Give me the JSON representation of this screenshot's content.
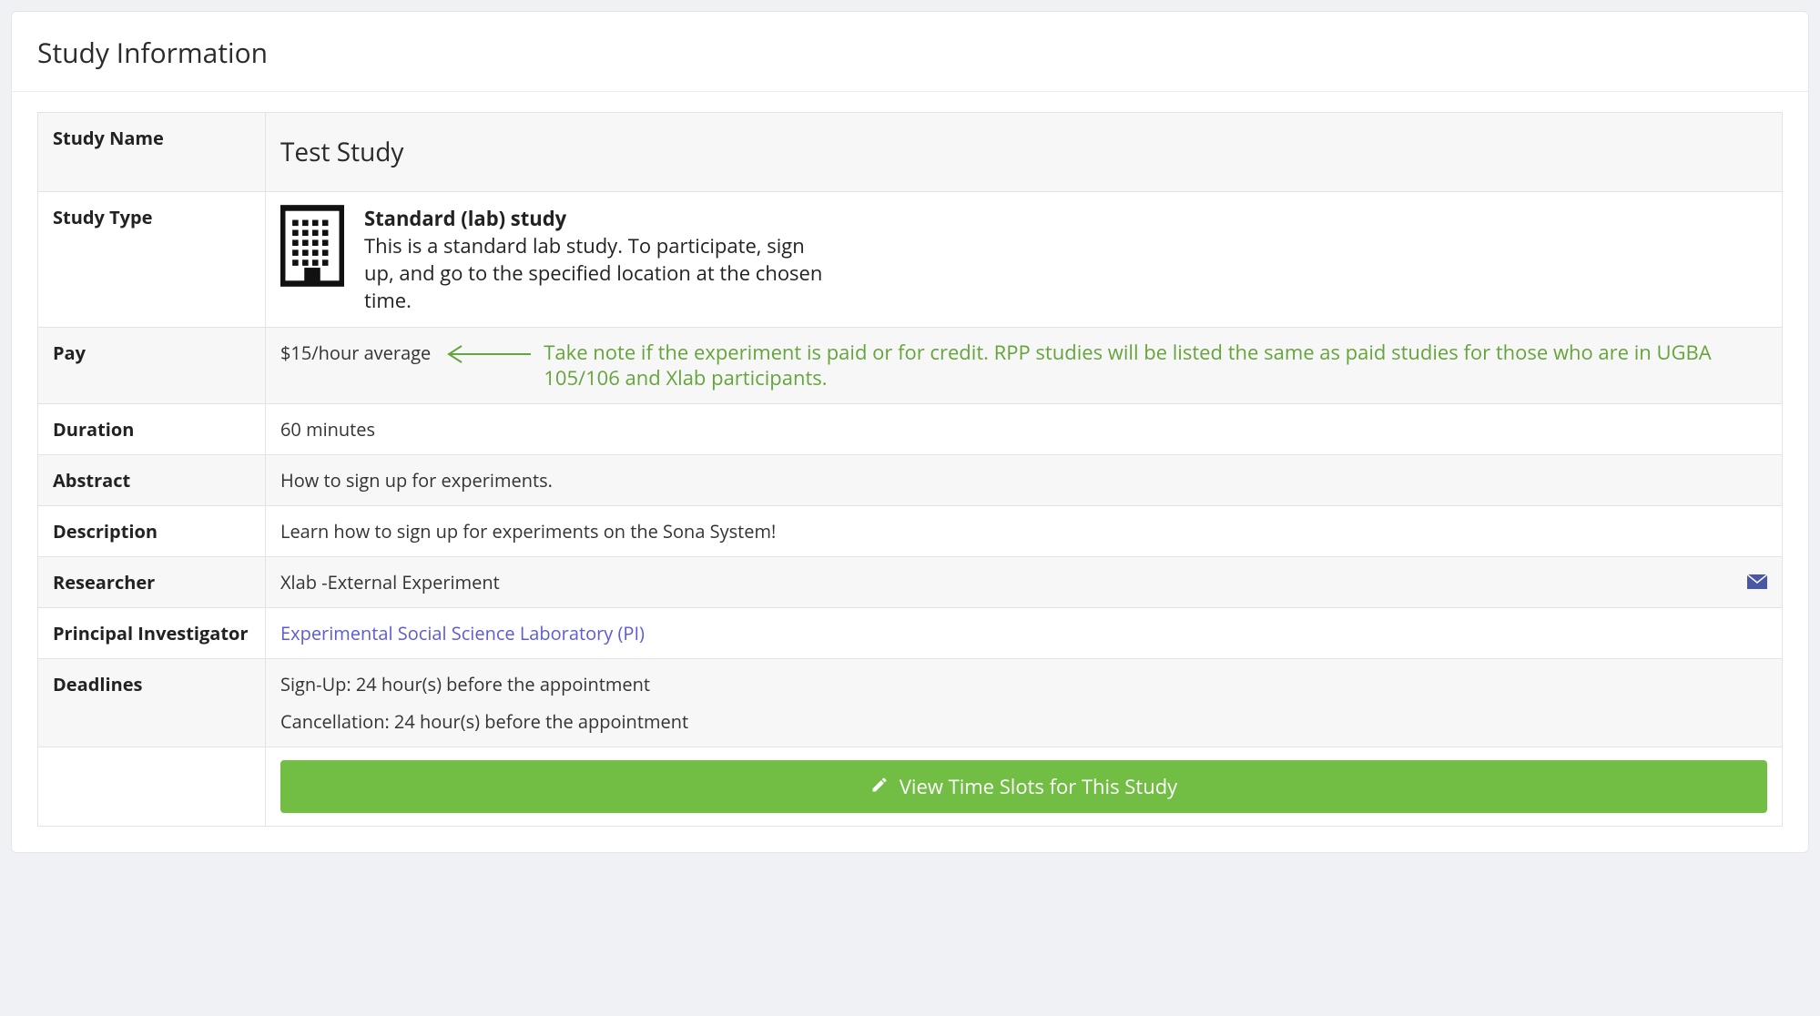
{
  "panel": {
    "title": "Study Information"
  },
  "labels": {
    "study_name": "Study Name",
    "study_type": "Study Type",
    "pay": "Pay",
    "duration": "Duration",
    "abstract": "Abstract",
    "description": "Description",
    "researcher": "Researcher",
    "principal_investigator": "Principal Investigator",
    "deadlines": "Deadlines"
  },
  "study": {
    "name": "Test Study",
    "type": {
      "title": "Standard (lab) study",
      "description": "This is a standard lab study. To participate, sign up, and go to the specified location at the chosen time."
    },
    "pay": "$15/hour average",
    "duration": "60 minutes",
    "abstract": "How to sign up for experiments.",
    "description": "Learn how to sign up for experiments on the Sona System!",
    "researcher": "Xlab -External Experiment",
    "principal_investigator": "Experimental Social Science Laboratory (PI)",
    "deadlines": {
      "signup": "Sign-Up:  24 hour(s) before the appointment",
      "cancellation": "Cancellation:  24 hour(s) before the appointment"
    }
  },
  "annotations": {
    "pay_note": "Take note if the experiment is paid or for credit. RPP studies will be listed the same as paid studies for those who are in UGBA 105/106 and Xlab participants."
  },
  "actions": {
    "view_timeslots": "View Time Slots for This Study"
  },
  "colors": {
    "cta_green": "#72be44",
    "annotation_green": "#64a43a",
    "pi_link": "#5b5bd6"
  }
}
